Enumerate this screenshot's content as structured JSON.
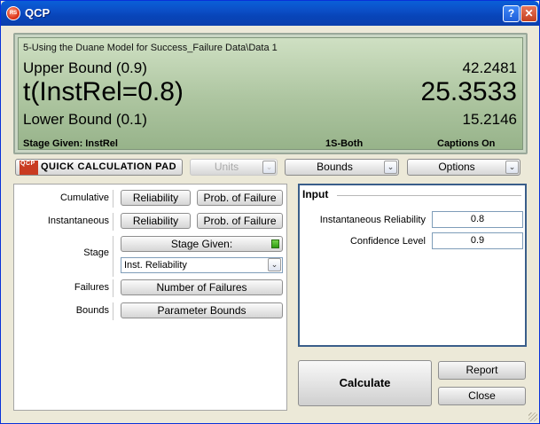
{
  "window": {
    "title": "QCP",
    "help_glyph": "?",
    "close_glyph": "✕"
  },
  "display": {
    "path": "5-Using the Duane Model for Success_Failure Data\\Data 1",
    "upper_label": "Upper Bound (0.9)",
    "upper_value": "42.2481",
    "main_label": "t(InstRel=0.8)",
    "main_value": "25.3533",
    "lower_label": "Lower Bound (0.1)",
    "lower_value": "15.2146",
    "footer_stage": "Stage Given: InstRel",
    "footer_sides": "1S-Both",
    "footer_captions": "Captions On"
  },
  "toolbar": {
    "logo_text": "QCP",
    "qcp_label": "Quick Calculation Pad",
    "units_label": "Units",
    "bounds_label": "Bounds",
    "options_label": "Options"
  },
  "left": {
    "cumulative_label": "Cumulative",
    "instantaneous_label": "Instantaneous",
    "stage_label": "Stage",
    "failures_label": "Failures",
    "bounds_label": "Bounds",
    "reliability_btn": "Reliability",
    "prob_failure_btn": "Prob. of Failure",
    "stage_given_btn": "Stage Given:",
    "stage_select_value": "Inst. Reliability",
    "num_failures_btn": "Number of Failures",
    "param_bounds_btn": "Parameter Bounds"
  },
  "input": {
    "heading": "Input",
    "inst_rel_label": "Instantaneous Reliability",
    "inst_rel_value": "0.8",
    "conf_label": "Confidence Level",
    "conf_value": "0.9"
  },
  "actions": {
    "calculate": "Calculate",
    "report": "Report",
    "close": "Close"
  },
  "colors": {
    "title_bar": "#0a5fd8",
    "lcd": "#adc5a0",
    "input_border": "#3a5e8a"
  }
}
